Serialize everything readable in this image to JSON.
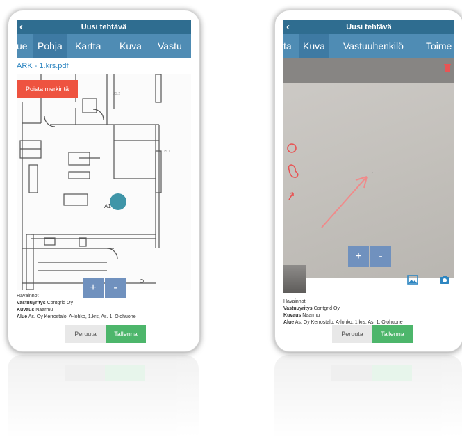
{
  "left_screen": {
    "title": "Uusi tehtävä",
    "tabs": [
      "ue",
      "Pohja",
      "Kartta",
      "Kuva",
      "Vastu"
    ],
    "active_tab": "Pohja",
    "filename": "ARK - 1.krs.pdf",
    "delete_marker_label": "Poista merkintä",
    "room_label": "A1",
    "zoom_in": "+",
    "zoom_out": "-",
    "info": {
      "line1": "Havainnot",
      "line2_label": "Vastuuyritys",
      "line2_value": "Contgrid Oy",
      "line3_label": "Kuvaus",
      "line3_value": "Naarmu",
      "line4_label": "Alue",
      "line4_value": "As. Oy Kerrostalo, A-lohko, 1.krs, As. 1, Olohuone"
    },
    "cancel_label": "Peruuta",
    "save_label": "Tallenna"
  },
  "right_screen": {
    "title": "Uusi tehtävä",
    "tabs": [
      "ta",
      "Kuva",
      "Vastuuhenkilö",
      "Toime"
    ],
    "active_tab": "Kuva",
    "zoom_in": "+",
    "zoom_out": "-",
    "info": {
      "line1": "Havainnot",
      "line2_label": "Vastuuyritys",
      "line2_value": "Contgrid Oy",
      "line3_label": "Kuvaus",
      "line3_value": "Naarmu",
      "line4_label": "Alue",
      "line4_value": "As. Oy Kerrostalo, A-lohko, 1.krs, As. 1, Olohuone"
    },
    "cancel_label": "Peruuta",
    "save_label": "Tallenna"
  },
  "colors": {
    "header": "#2f6d90",
    "tabs": "#4f8cb4",
    "delete": "#ee5340",
    "save": "#4db66b",
    "zoom": "#7091be",
    "annotation": "#e85454",
    "marker": "#3f95a8"
  },
  "icons": [
    "back-arrow-icon",
    "gallery-icon",
    "camera-icon",
    "delete-icon"
  ]
}
